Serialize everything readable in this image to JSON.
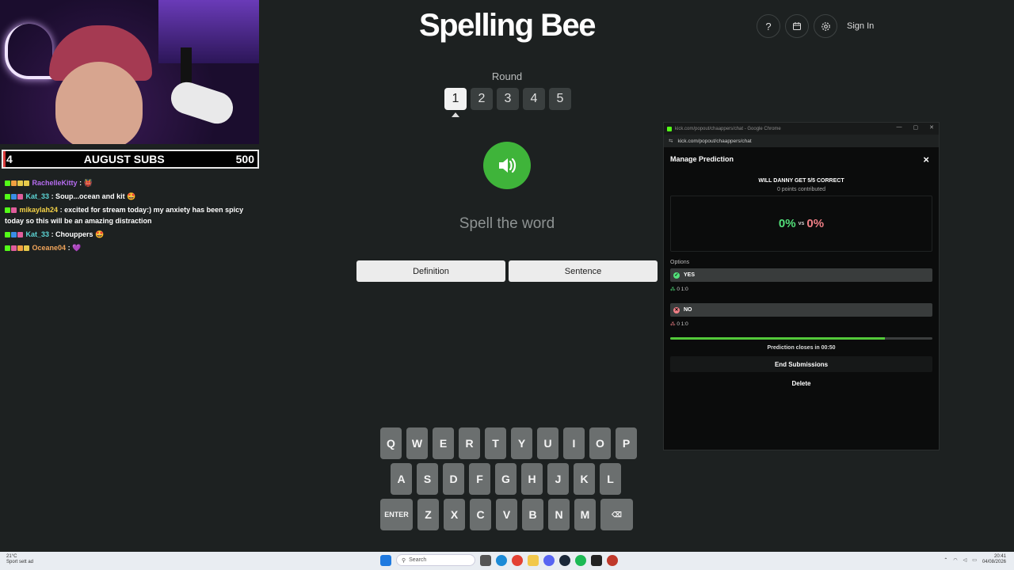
{
  "subs_bar": {
    "left": "4",
    "title": "AUGUST SUBS",
    "right": "500"
  },
  "chat": [
    {
      "user": "RachelleKitty",
      "color": "#b66cf0",
      "text": ": 👹"
    },
    {
      "user": "Kat_33",
      "color": "#5dd6d6",
      "text": ": Soup...ocean and kit 🤩"
    },
    {
      "user": "mikaylah24",
      "color": "#f5d347",
      "text": ": excited for stream today:) my anxiety has been spicy today so this will be an amazing distraction"
    },
    {
      "user": "Kat_33",
      "color": "#5dd6d6",
      "text": ": Chouppers 🤩"
    },
    {
      "user": "Oceane04",
      "color": "#f0a45a",
      "text": ": 💜"
    }
  ],
  "game": {
    "title": "Spelling Bee",
    "sign_in": "Sign In",
    "help_icon": "?",
    "round_label": "Round",
    "rounds": [
      "1",
      "2",
      "3",
      "4",
      "5"
    ],
    "active_round": 1,
    "prompt": "Spell the word",
    "definition_label": "Definition",
    "sentence_label": "Sentence",
    "keyboard": {
      "row1": [
        "Q",
        "W",
        "E",
        "R",
        "T",
        "Y",
        "U",
        "I",
        "O",
        "P"
      ],
      "row2": [
        "A",
        "S",
        "D",
        "F",
        "G",
        "H",
        "J",
        "K",
        "L"
      ],
      "row3": [
        "ENTER",
        "Z",
        "X",
        "C",
        "V",
        "B",
        "N",
        "M",
        "⌫"
      ]
    }
  },
  "prediction": {
    "window_title": "kick.com/popout/chaappers/chat - Google Chrome",
    "url": "kick.com/popout/chaappers/chat",
    "header": "Manage Prediction",
    "close": "×",
    "question": "WILL DANNY GET 5/5 CORRECT",
    "points": "0 points contributed",
    "yes_pct": "0%",
    "vs": "vs",
    "no_pct": "0%",
    "options_label": "Options",
    "yes_label": "YES",
    "yes_stats": "0  1:0",
    "no_label": "NO",
    "no_stats": "0  1:0",
    "progress": 0.82,
    "closes": "Prediction closes in 00:50",
    "end_label": "End Submissions",
    "delete_label": "Delete"
  },
  "taskbar": {
    "weather_temp": "21°C",
    "weather_text": "Sport sett ad",
    "search": "Search",
    "time": "20:41",
    "date": "04/08/2026"
  }
}
